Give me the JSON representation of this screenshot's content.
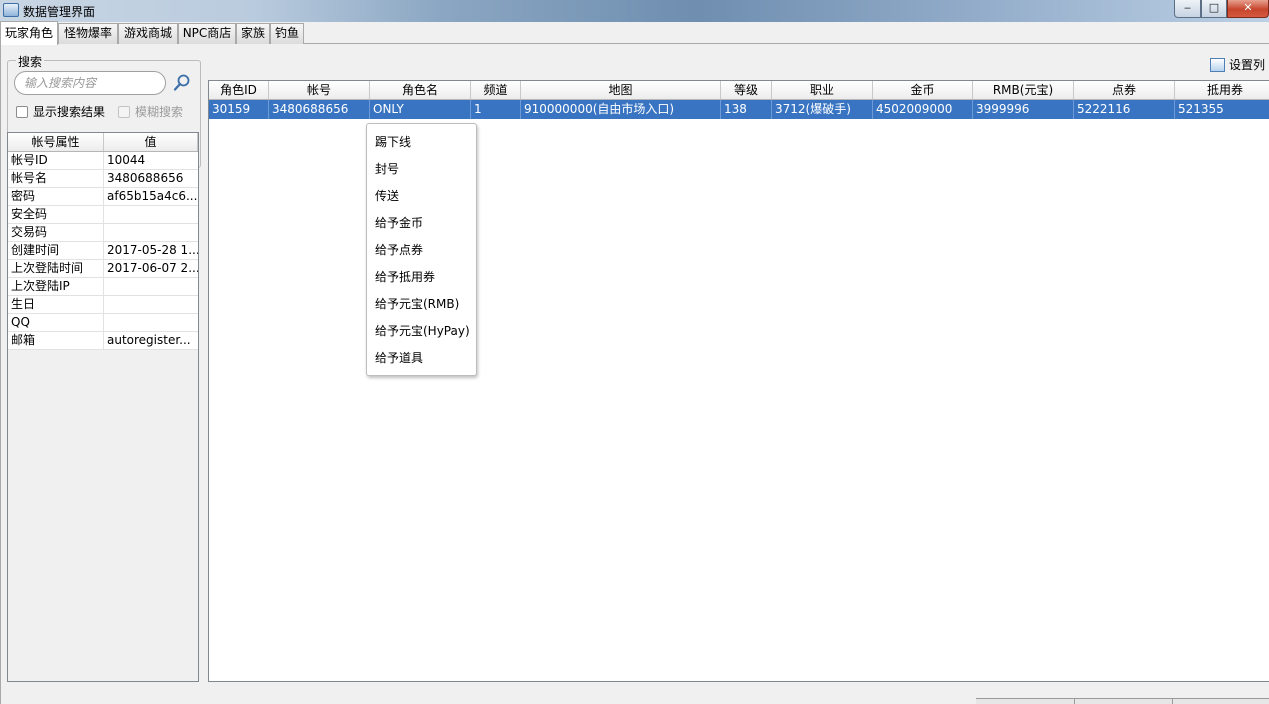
{
  "window": {
    "title": "数据管理界面",
    "controls": {
      "minimize": "‒",
      "maximize": "□",
      "close": "✕"
    }
  },
  "tabs": [
    {
      "label": "玩家角色",
      "active": true
    },
    {
      "label": "怪物爆率",
      "active": false
    },
    {
      "label": "游戏商城",
      "active": false
    },
    {
      "label": "NPC商店",
      "active": false
    },
    {
      "label": "家族",
      "active": false
    },
    {
      "label": "钓鱼",
      "active": false
    }
  ],
  "search": {
    "group_label": "搜索",
    "placeholder": "输入搜索内容",
    "button_icon": "search-icon",
    "show_results_label": "显示搜索结果",
    "show_results_checked": false,
    "fuzzy_label": "模糊搜索",
    "fuzzy_checked": false,
    "fuzzy_enabled": false
  },
  "account_props": {
    "headers": [
      "帐号属性",
      "值"
    ],
    "rows": [
      {
        "key": "帐号ID",
        "value": "10044"
      },
      {
        "key": "帐号名",
        "value": "3480688656"
      },
      {
        "key": "密码",
        "value": "af65b15a4c6..."
      },
      {
        "key": "安全码",
        "value": ""
      },
      {
        "key": "交易码",
        "value": ""
      },
      {
        "key": "创建时间",
        "value": "2017-05-28 1..."
      },
      {
        "key": "上次登陆时间",
        "value": "2017-06-07 2..."
      },
      {
        "key": "上次登陆IP",
        "value": ""
      },
      {
        "key": "生日",
        "value": ""
      },
      {
        "key": "QQ",
        "value": ""
      },
      {
        "key": "邮箱",
        "value": "autoregister..."
      }
    ]
  },
  "column_settings": {
    "label": "设置列",
    "icon": "table-settings-icon"
  },
  "character_grid": {
    "headers": [
      "角色ID",
      "帐号",
      "角色名",
      "频道",
      "地图",
      "等级",
      "职业",
      "金币",
      "RMB(元宝)",
      "点券",
      "抵用券"
    ],
    "rows": [
      [
        "30159",
        "3480688656",
        "ONLY",
        "1",
        "910000000(自由市场入口)",
        "138",
        "3712(爆破手)",
        "4502009000",
        "3999996",
        "5222116",
        "521355"
      ]
    ],
    "selected_row": 0
  },
  "context_menu": {
    "items": [
      "踢下线",
      "封号",
      "传送",
      "给予金币",
      "给予点券",
      "给予抵用券",
      "给予元宝(RMB)",
      "给予元宝(HyPay)",
      "给予道具"
    ]
  },
  "colors": {
    "selection": "#3874c2",
    "close_button": "#c6452c"
  }
}
